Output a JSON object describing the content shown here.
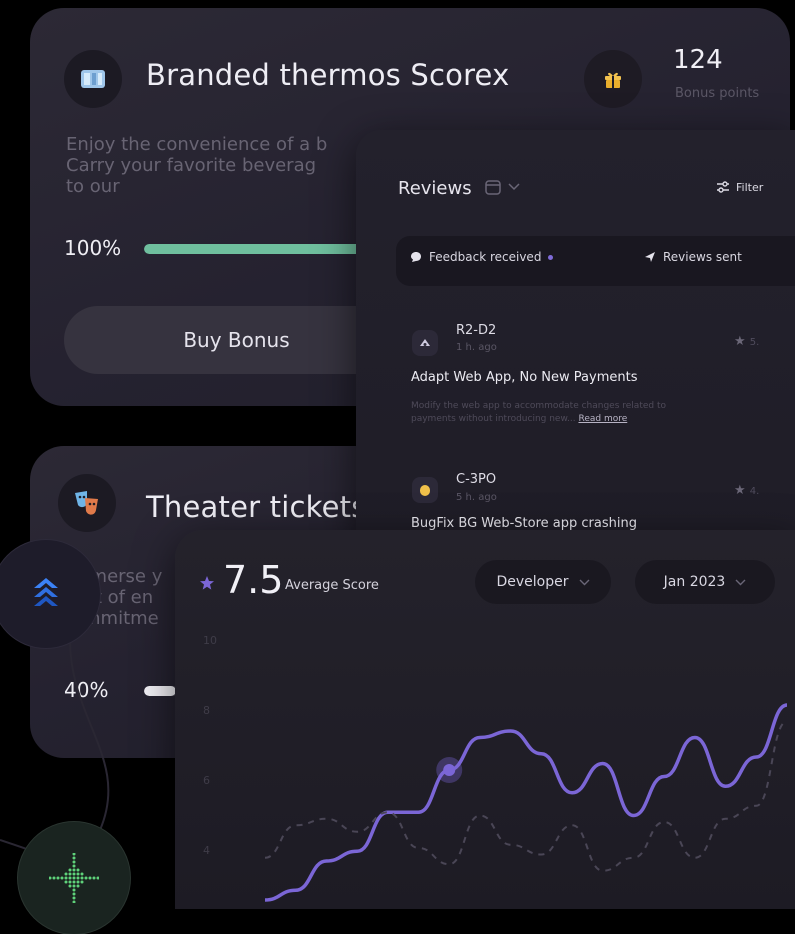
{
  "product_card": {
    "title": "Branded thermos Scorex",
    "description": "Enjoy the convenience of a b\nCarry your favorite beverag\nto our",
    "progress_label": "100%",
    "progress_value": 1.0,
    "buy_label": "Buy Bonus",
    "points_value": "124",
    "points_label": "Bonus points",
    "accent": "#6fbf9e"
  },
  "theater_card": {
    "title": "Theater tickets",
    "description": "mmerse y\nght of en\nommitme",
    "progress_label": "40%",
    "progress_value": 0.4
  },
  "reviews": {
    "title": "Reviews",
    "filter_label": "Filter",
    "tabs": [
      {
        "label": "Feedback received",
        "active": true
      },
      {
        "label": "Reviews sent",
        "active": false
      }
    ],
    "items": [
      {
        "name": "R2-D2",
        "time": "1 h. ago",
        "rating": "5.",
        "headline": "Adapt Web App, No New Payments",
        "body": "Modify the web app to accommodate changes related to\npayments without introducing new...",
        "more": "Read more"
      },
      {
        "name": "C-3PO",
        "time": "5 h. ago",
        "rating": "4.",
        "headline": "BugFix BG Web-Store app crashing",
        "body": "",
        "more": ""
      }
    ]
  },
  "score_chart": {
    "score": "7.5",
    "score_label": "Average Score",
    "role_filter": "Developer",
    "period_filter": "Jan 2023",
    "accent": "#7b66d6"
  },
  "chart_data": {
    "type": "line",
    "yticks": [
      "10",
      "8",
      "6",
      "4"
    ],
    "ylim": [
      3,
      11
    ],
    "series": [
      {
        "values": [
          3.0,
          3.3,
          4.2,
          4.5,
          5.7,
          5.7,
          7.0,
          8.0,
          8.2,
          7.5,
          6.3,
          7.2,
          5.6,
          6.8,
          8.0,
          6.5,
          7.4,
          9.0
        ]
      },
      {
        "dashed": true,
        "values": [
          4.3,
          5.3,
          5.5,
          5.1,
          5.7,
          4.6,
          4.1,
          5.6,
          4.7,
          4.4,
          5.3,
          3.9,
          4.3,
          5.4,
          4.3,
          5.5,
          5.9,
          8.5
        ]
      }
    ],
    "highlight_index": 6
  }
}
